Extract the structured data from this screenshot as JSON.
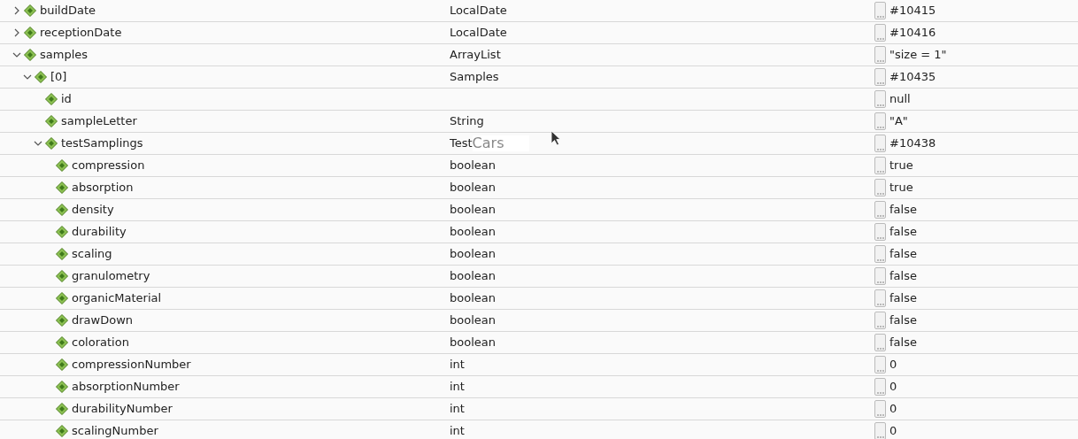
{
  "variables": [
    {
      "name": "buildDate",
      "type": "LocalDate",
      "value": "#10415",
      "expanded": false
    },
    {
      "name": "receptionDate",
      "type": "LocalDate",
      "value": "#10416",
      "expanded": false
    },
    {
      "name": "samples",
      "type": "ArrayList",
      "value": "\"size = 1\"",
      "expanded": true,
      "children": [
        {
          "name": "[0]",
          "type": "Samples",
          "value": "#10435",
          "expanded": true,
          "children": [
            {
              "name": "id",
              "value": "null"
            },
            {
              "name": "sampleLetter",
              "type": "String",
              "value": "\"A\""
            },
            {
              "name": "testSamplings",
              "type": "Test",
              "type_overlay": "Cars",
              "value": "#10438",
              "expanded": true,
              "children": [
                {
                  "name": "compression",
                  "type": "boolean",
                  "value": "true"
                },
                {
                  "name": "absorption",
                  "type": "boolean",
                  "value": "true"
                },
                {
                  "name": "density",
                  "type": "boolean",
                  "value": "false"
                },
                {
                  "name": "durability",
                  "type": "boolean",
                  "value": "false"
                },
                {
                  "name": "scaling",
                  "type": "boolean",
                  "value": "false"
                },
                {
                  "name": "granulometry",
                  "type": "boolean",
                  "value": "false"
                },
                {
                  "name": "organicMaterial",
                  "type": "boolean",
                  "value": "false"
                },
                {
                  "name": "drawDown",
                  "type": "boolean",
                  "value": "false"
                },
                {
                  "name": "coloration",
                  "type": "boolean",
                  "value": "false"
                },
                {
                  "name": "compressionNumber",
                  "type": "int",
                  "value": "0"
                },
                {
                  "name": "absorptionNumber",
                  "type": "int",
                  "value": "0"
                },
                {
                  "name": "durabilityNumber",
                  "type": "int",
                  "value": "0"
                },
                {
                  "name": "scalingNumber",
                  "type": "int",
                  "value": "0"
                }
              ]
            }
          ]
        }
      ]
    }
  ]
}
